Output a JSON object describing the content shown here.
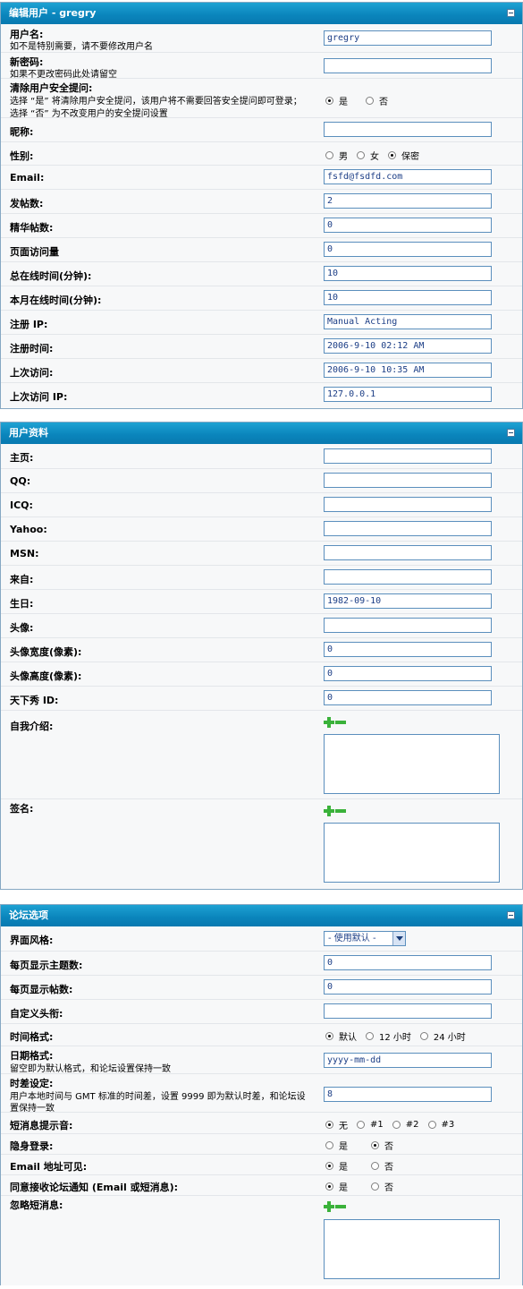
{
  "edit_user": {
    "title": "编辑用户  - gregry",
    "username": {
      "label": "用户名:",
      "desc": "如不是特别需要，请不要修改用户名",
      "value": "gregry"
    },
    "new_password": {
      "label": "新密码:",
      "desc": "如果不更改密码此处请留空",
      "value": ""
    },
    "clear_security": {
      "label": "清除用户安全提问:",
      "desc1": "选择 “是” 将清除用户安全提问，该用户将不需要回答安全提问即可登录；",
      "desc2": "选择 “否” 为不改变用户的安全提问设置",
      "opt_yes": "是",
      "opt_no": "否",
      "selected": "是"
    },
    "nickname": {
      "label": "昵称:",
      "value": ""
    },
    "gender": {
      "label": "性别:",
      "opt_male": "男",
      "opt_female": "女",
      "opt_secret": "保密",
      "selected": "保密"
    },
    "email": {
      "label": "Email:",
      "value": "fsfd@fsdfd.com"
    },
    "posts": {
      "label": "发帖数:",
      "value": "2"
    },
    "digest_posts": {
      "label": "精华帖数:",
      "value": "0"
    },
    "page_views": {
      "label": "页面访问量",
      "value": "0"
    },
    "total_online": {
      "label": "总在线时间(分钟):",
      "value": "10"
    },
    "month_online": {
      "label": "本月在线时间(分钟):",
      "value": "10"
    },
    "reg_ip": {
      "label": "注册  IP:",
      "value": "Manual Acting"
    },
    "reg_time": {
      "label": "注册时间:",
      "value": "2006-9-10 02:12 AM"
    },
    "last_visit": {
      "label": "上次访问:",
      "value": "2006-9-10 10:35 AM"
    },
    "last_ip": {
      "label": "上次访问  IP:",
      "value": "127.0.0.1"
    }
  },
  "profile": {
    "title": "用户资料",
    "homepage": {
      "label": "主页:",
      "value": ""
    },
    "qq": {
      "label": "QQ:",
      "value": ""
    },
    "icq": {
      "label": "ICQ:",
      "value": ""
    },
    "yahoo": {
      "label": "Yahoo:",
      "value": ""
    },
    "msn": {
      "label": "MSN:",
      "value": ""
    },
    "from": {
      "label": "来自:",
      "value": ""
    },
    "birthday": {
      "label": "生日:",
      "value": "1982-09-10"
    },
    "avatar": {
      "label": "头像:",
      "value": ""
    },
    "avatar_width": {
      "label": "头像宽度(像素):",
      "value": "0"
    },
    "avatar_height": {
      "label": "头像高度(像素):",
      "value": "0"
    },
    "txs_id": {
      "label": "天下秀  ID:",
      "value": "0"
    },
    "bio": {
      "label": "自我介绍:"
    },
    "signature": {
      "label": "签名:"
    }
  },
  "forum": {
    "title": "论坛选项",
    "style": {
      "label": "界面风格:",
      "value": "- 使用默认 -"
    },
    "topics_per_page": {
      "label": "每页显示主题数:",
      "value": "0"
    },
    "posts_per_page": {
      "label": "每页显示帖数:",
      "value": "0"
    },
    "custom_title": {
      "label": "自定义头衔:",
      "value": ""
    },
    "time_format": {
      "label": "时间格式:",
      "opt_default": "默认",
      "opt_12": "12 小时",
      "opt_24": "24 小时",
      "selected": "默认"
    },
    "date_format": {
      "label": "日期格式:",
      "desc": "留空即为默认格式，和论坛设置保持一致",
      "value": "yyyy-mm-dd"
    },
    "timezone": {
      "label": "时差设定:",
      "desc1": "用户本地时间与  GMT 标准的时间差，设置  9999 即为默认时差，和论坛设",
      "desc2": "置保持一致",
      "value": "8"
    },
    "pm_sound": {
      "label": "短消息提示音:",
      "opt_none": "无",
      "opt_1": "#1",
      "opt_2": "#2",
      "opt_3": "#3",
      "selected": "无"
    },
    "invisible": {
      "label": "隐身登录:",
      "opt_yes": "是",
      "opt_no": "否",
      "selected": "否"
    },
    "email_visible": {
      "label": "Email 地址可见:",
      "opt_yes": "是",
      "opt_no": "否",
      "selected": "是"
    },
    "notify": {
      "label": "同意接收论坛通知  (Email 或短消息):",
      "opt_yes": "是",
      "opt_no": "否",
      "selected": "是"
    },
    "ignore_pm": {
      "label": "忽略短消息:"
    }
  }
}
